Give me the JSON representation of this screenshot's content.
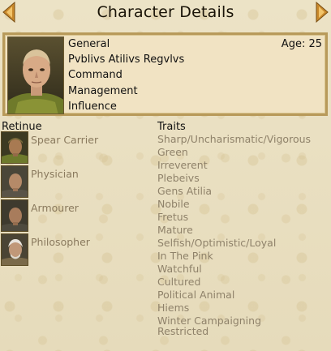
{
  "window": {
    "title": "Character Details"
  },
  "character": {
    "rank": "General",
    "age_label": "Age: 25",
    "name": "Pvblivs Atilivs Regvlvs",
    "stats": [
      "Command",
      "Management",
      "Influence"
    ]
  },
  "retinue": {
    "heading": "Retinue",
    "items": [
      {
        "label": "Spear Carrier",
        "icon": "spear-carrier-portrait"
      },
      {
        "label": "Physician",
        "icon": "physician-portrait"
      },
      {
        "label": "Armourer",
        "icon": "armourer-portrait"
      },
      {
        "label": "Philosopher",
        "icon": "philosopher-portrait"
      }
    ]
  },
  "traits": {
    "heading": "Traits",
    "items": [
      "Sharp/Uncharismatic/Vigorous",
      "Green",
      "Irreverent",
      "Plebeivs",
      "Gens Atilia",
      "Nobile",
      "Fretus",
      "Mature",
      "Selfish/Optimistic/Loyal",
      "In The Pink",
      "Watchful",
      "Cultured",
      "Political Animal",
      "Hiems",
      "Winter Campaigning",
      "Restricted"
    ]
  },
  "colors": {
    "background": "#ece2c3",
    "panel": "#f1e3c3",
    "panel_border": "#b89a5a",
    "muted_text": "#8f826a",
    "arrow": "#c9892c"
  }
}
